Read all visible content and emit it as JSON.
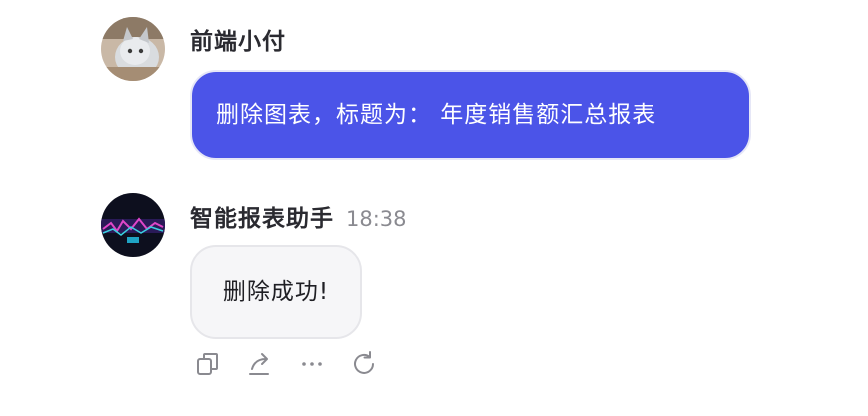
{
  "user_message": {
    "sender": "前端小付",
    "text": "删除图表，标题为： 年度销售额汇总报表"
  },
  "bot_message": {
    "sender": "智能报表助手",
    "time": "18:38",
    "text": "删除成功!"
  },
  "actions": [
    {
      "icon": "copy-icon"
    },
    {
      "icon": "share-icon"
    },
    {
      "icon": "more-icon"
    },
    {
      "icon": "refresh-icon"
    }
  ],
  "colors": {
    "user_bubble": "#4b54e8",
    "bot_bubble": "#f6f6f8",
    "accent": "#4b54e8"
  }
}
